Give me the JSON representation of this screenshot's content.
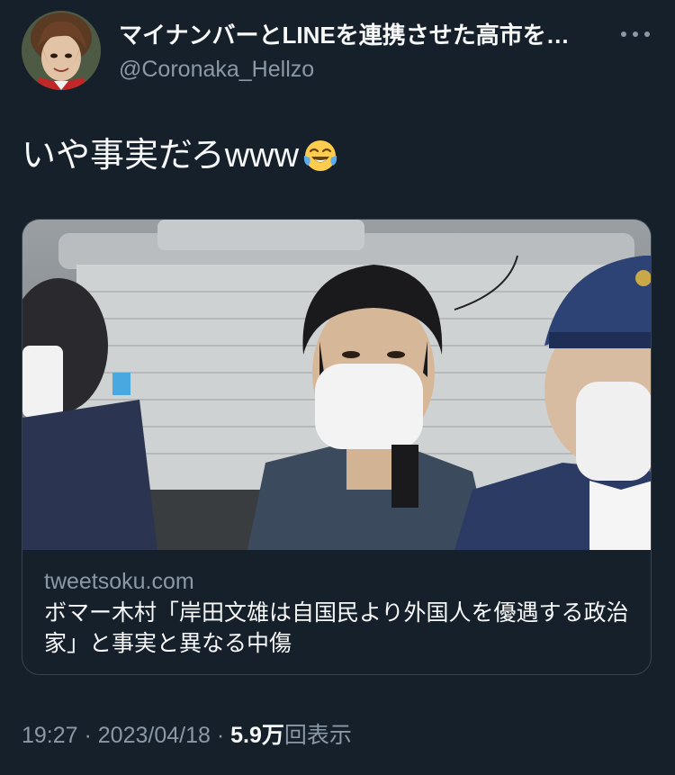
{
  "author": {
    "display_name": "マイナンバーとLINEを連携させた高市を…",
    "handle": "@Coronaka_Hellzo"
  },
  "tweet": {
    "text": "いや事実だろwww",
    "emoji": "face-with-tears-of-joy-emoji"
  },
  "card": {
    "domain": "tweetsoku.com",
    "title": "ボマー木村「岸田文雄は自国民より外国人を優遇する政治家」と事実と異なる中傷"
  },
  "meta": {
    "time": "19:27",
    "separator1": " · ",
    "date": "2023/04/18",
    "separator2": " · ",
    "views": "5.9万",
    "views_label": "回表示"
  },
  "colors": {
    "background": "#15202b",
    "text_primary": "#f7f9f9",
    "text_secondary": "#8b98a5",
    "border": "#38444d"
  }
}
